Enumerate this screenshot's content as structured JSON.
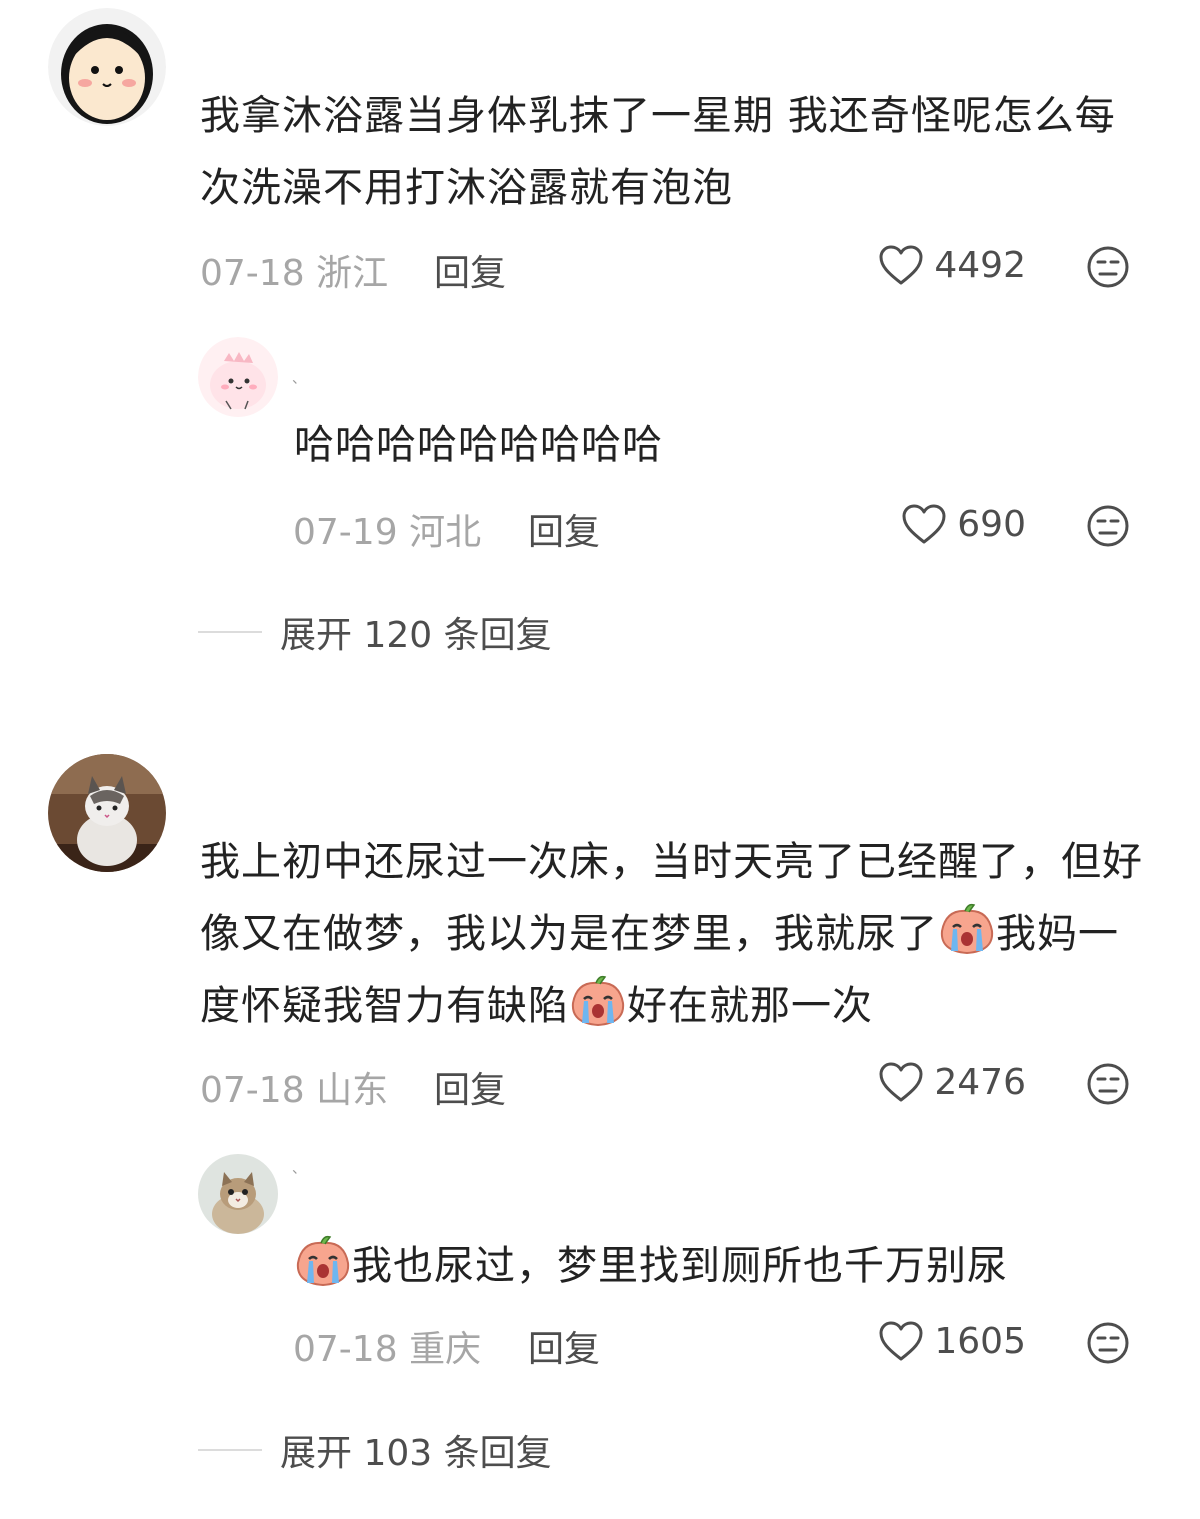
{
  "comments": [
    {
      "avatar_icon": "cartoon-face-avatar",
      "nickname": "",
      "text": "我拿沐浴露当身体乳抹了一星期 我还奇怪呢怎么每次洗澡不用打沐浴露就有泡泡",
      "date": "07-18",
      "location": "浙江",
      "reply_label": "回复",
      "likes": "4492",
      "replies": [
        {
          "avatar_icon": "pink-dinosaur-avatar",
          "nickname": "、",
          "text": "哈哈哈哈哈哈哈哈哈",
          "date": "07-19",
          "location": "河北",
          "reply_label": "回复",
          "likes": "690"
        }
      ],
      "expand_label": "展开 120 条回复"
    },
    {
      "avatar_icon": "fluffy-cat-avatar",
      "nickname": "",
      "text_parts": [
        "我上初中还尿过一次床，当时天亮了已经醒了，但好像又在做梦，我以为是在梦里，我就尿了",
        "我妈一度怀疑我智力有缺陷",
        "好在就那一次"
      ],
      "emoji_icon": "crying-peach-emoji",
      "date": "07-18",
      "location": "山东",
      "reply_label": "回复",
      "likes": "2476",
      "replies": [
        {
          "avatar_icon": "kitten-avatar",
          "nickname": "、",
          "text": "我也尿过，梦里找到厕所也千万别尿",
          "emoji_icon": "crying-peach-emoji",
          "date": "07-18",
          "location": "重庆",
          "reply_label": "回复",
          "likes": "1605"
        }
      ],
      "expand_label": "展开 103 条回复"
    }
  ],
  "colors": {
    "text": "#222222",
    "meta": "#a6a6a6",
    "action": "#4d4d4d",
    "divider": "#dcdcdc"
  }
}
